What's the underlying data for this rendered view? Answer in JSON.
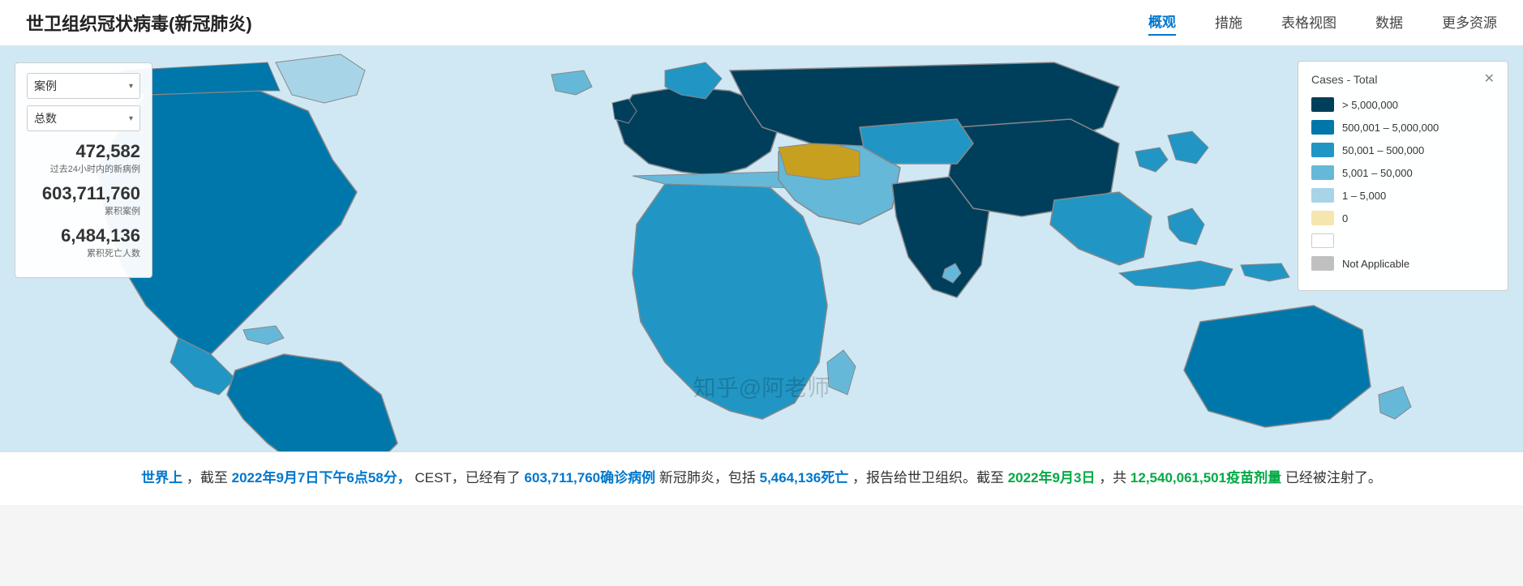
{
  "header": {
    "title": "世卫组织冠状病毒(新冠肺炎)",
    "nav": [
      {
        "label": "概观",
        "active": true
      },
      {
        "label": "措施",
        "active": false
      },
      {
        "label": "表格视图",
        "active": false
      },
      {
        "label": "数据",
        "active": false
      },
      {
        "label": "更多资源",
        "active": false
      }
    ]
  },
  "left_panel": {
    "dropdown1_label": "案例",
    "dropdown2_label": "总数",
    "stat1_value": "472,582",
    "stat1_label": "过去24小时内的新病例",
    "stat2_value": "603,711,760",
    "stat2_label": "累积案例",
    "stat3_value": "6,484,136",
    "stat3_label": "累积死亡人数"
  },
  "legend": {
    "title": "Cases - Total",
    "close_symbol": "✕",
    "items": [
      {
        "color": "#003f5c",
        "label": "> 5,000,000"
      },
      {
        "color": "#0077aa",
        "label": "500,001 – 5,000,000"
      },
      {
        "color": "#2196c4",
        "label": "50,001 – 500,000"
      },
      {
        "color": "#66b8d9",
        "label": "5,001 – 50,000"
      },
      {
        "color": "#a8d4e8",
        "label": "1 – 5,000"
      },
      {
        "color": "#f5e6b0",
        "label": "0"
      },
      {
        "color": "#ffffff",
        "label": ""
      },
      {
        "color": "#c0c0c0",
        "label": "Not Applicable"
      }
    ]
  },
  "bottom_text": {
    "prefix": "世界上",
    "sentence1": "，截至 2022年9月7日下午6点58分， CEST，已经有了 603,711,760确诊病例 新冠肺炎，包括 5,464,136死亡，报告给世卫组织。截至 2022年9月3日，共 12,540,061,501疫苗剂量 已经被注射了。",
    "date_highlight": "2022年9月7日下午6点58分",
    "cases_highlight": "603,711,760确诊病例",
    "deaths_highlight": "5,464,136死亡",
    "vaccine_date": "2022年9月3日",
    "vaccine_highlight": "12,540,061,501疫苗剂量"
  },
  "watermark": "知乎@阿老师"
}
